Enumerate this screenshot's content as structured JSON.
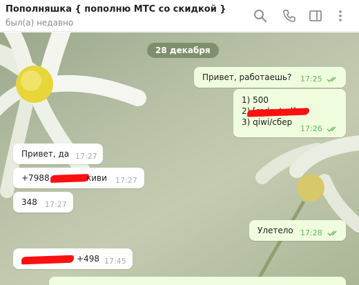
{
  "header": {
    "title": "Пополняшка { пополню МТС со скидкой }",
    "status": "был(а) недавно",
    "icons": [
      "search-icon",
      "phone-icon",
      "sidebar-toggle-icon",
      "more-vertical-icon"
    ]
  },
  "chat": {
    "date": "28 декабря",
    "messages": [
      {
        "direction": "out",
        "text": "Привет, работаешь?",
        "time": "17:25",
        "read": true
      },
      {
        "direction": "out",
        "lines": [
          "1) 500",
          "2) [redacted]",
          "3) qiwi/сбер"
        ],
        "time": "17:26",
        "read": true
      },
      {
        "direction": "in",
        "text": "Привет, да",
        "time": "17:27"
      },
      {
        "direction": "in",
        "text_before": "+7988",
        "text_after": "киви",
        "time": "17:27"
      },
      {
        "direction": "in",
        "text": "348",
        "time": "17:27"
      },
      {
        "direction": "out",
        "text": "Улетело",
        "time": "17:28",
        "read": true
      },
      {
        "direction": "in",
        "text_after": "+498",
        "time": "17:45"
      }
    ]
  },
  "colors": {
    "outgoing_bubble": "#effdde",
    "incoming_bubble": "#ffffff",
    "read_check": "#5fb85a",
    "redaction": "#ff1010",
    "date_pill": "#6e825a"
  }
}
